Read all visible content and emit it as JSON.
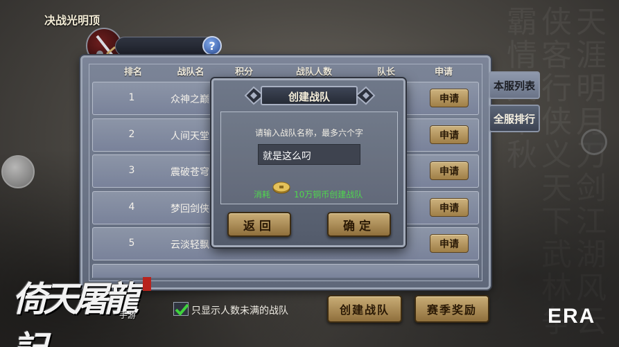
{
  "title": "决战光明顶",
  "help_label": "?",
  "table": {
    "headers": [
      "排名",
      "战队名",
      "积分",
      "战队人数",
      "队长",
      "申请"
    ],
    "rows": [
      {
        "rank": "1",
        "name": "众神之巅",
        "apply": "申请"
      },
      {
        "rank": "2",
        "name": "人间天堂",
        "apply": "申请"
      },
      {
        "rank": "3",
        "name": "震破苍穹",
        "apply": "申请"
      },
      {
        "rank": "4",
        "name": "梦回剑侠",
        "apply": "申请"
      },
      {
        "rank": "5",
        "name": "云淡轻飘",
        "apply": "申请"
      }
    ]
  },
  "side_tabs": [
    {
      "label": "本服列表",
      "active": true
    },
    {
      "label": "全服排行",
      "active": false
    }
  ],
  "dialog": {
    "title": "创建战队",
    "prompt": "请输入战队名称，最多六个字",
    "input_value": "就是这么叼",
    "cost_label": "消耗",
    "cost_text": "10万铜币创建战队",
    "back_label": "返回",
    "confirm_label": "确定"
  },
  "filter": {
    "checked": true,
    "label": "只显示人数未满的战队"
  },
  "bottom_buttons": {
    "create": "创建战队",
    "rewards": "赛季奖励"
  },
  "logo": {
    "text": "倚天屠龍記",
    "sub": "手游"
  },
  "watermark": "ERA",
  "colors": {
    "gold_button": "#b59560",
    "panel": "#6f7889",
    "cost_green": "#4fd84d"
  }
}
